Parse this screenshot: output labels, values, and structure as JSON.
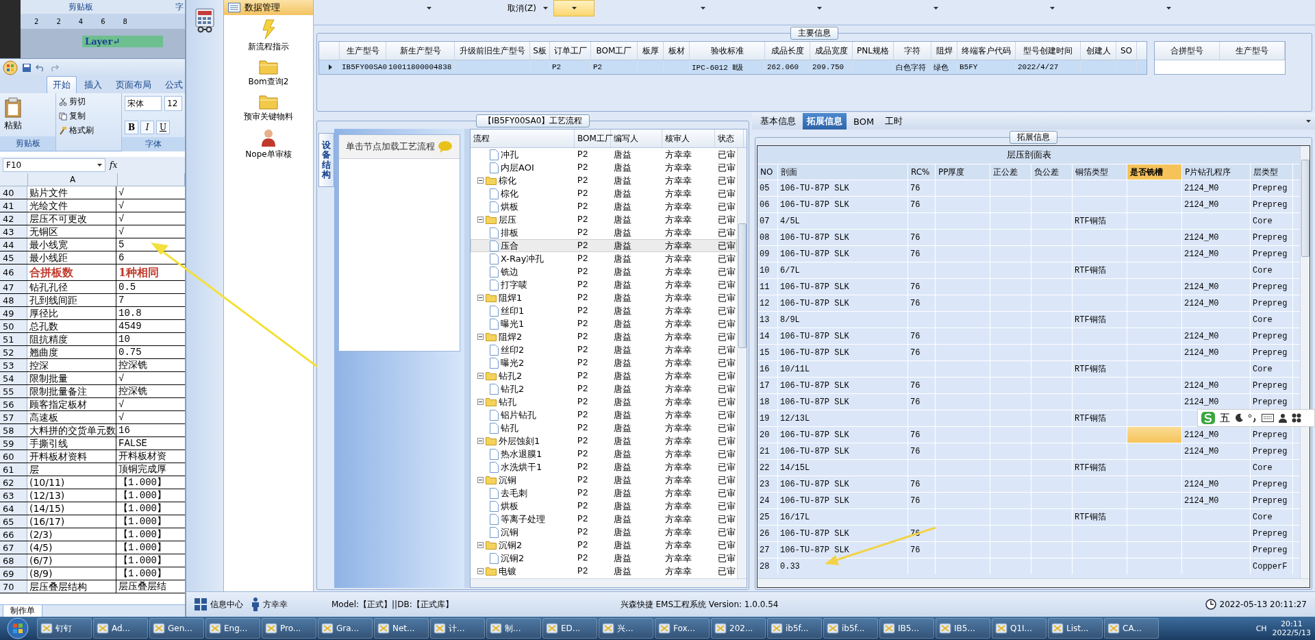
{
  "word_window": {
    "ribbon_groups": [
      "剪贴板",
      "字"
    ],
    "ruler_numbers": [
      "2",
      "2",
      "4",
      "6",
      "8"
    ],
    "cell_text": "Layer↵"
  },
  "excel": {
    "tabs": [
      {
        "label": "开始",
        "selected": true
      },
      {
        "label": "插入",
        "selected": false
      },
      {
        "label": "页面布局",
        "selected": false
      },
      {
        "label": "公式",
        "selected": false
      }
    ],
    "clipboard": {
      "paste": "粘贴",
      "cut": "剪切",
      "copy": "复制",
      "format_painter": "格式刷",
      "group": "剪贴板"
    },
    "font": {
      "name": "宋体",
      "size": "12",
      "bold": "B",
      "italic": "I",
      "underline": "U",
      "group": "字体"
    },
    "name_box": "F10",
    "fx": "fx",
    "column": "A",
    "rows": [
      {
        "n": "40",
        "a": "贴片文件",
        "b": "√",
        "kind": "plain"
      },
      {
        "n": "41",
        "a": "光绘文件",
        "b": "√",
        "kind": "plain"
      },
      {
        "n": "42",
        "a": "层压不可更改",
        "b": "√",
        "kind": "plain"
      },
      {
        "n": "43",
        "a": "无铜区",
        "b": "√",
        "kind": "plain"
      },
      {
        "n": "44",
        "a": "最小线宽",
        "b": "5",
        "kind": "plain"
      },
      {
        "n": "45",
        "a": "最小线距",
        "b": "6",
        "kind": "plain"
      },
      {
        "n": "46",
        "a": "合拼板数",
        "b": "1种相同",
        "kind": "emphasis"
      },
      {
        "n": "47",
        "a": "钻孔孔径",
        "b": "0.5",
        "kind": "plain"
      },
      {
        "n": "48",
        "a": "孔到线间距",
        "b": "7",
        "kind": "plain"
      },
      {
        "n": "49",
        "a": "厚径比",
        "b": "10.8",
        "kind": "plain"
      },
      {
        "n": "50",
        "a": "总孔数",
        "b": "4549",
        "kind": "plain"
      },
      {
        "n": "51",
        "a": "阻抗精度",
        "b": "10",
        "kind": "plain"
      },
      {
        "n": "52",
        "a": "翘曲度",
        "b": "0.75",
        "kind": "plain"
      },
      {
        "n": "53",
        "a": "控深",
        "b": "控深铣",
        "kind": "plain"
      },
      {
        "n": "54",
        "a": "限制批量",
        "b": "√",
        "kind": "plain"
      },
      {
        "n": "55",
        "a": "限制批量备注",
        "b": "控深铣",
        "kind": "plain"
      },
      {
        "n": "56",
        "a": "顾客指定板材",
        "b": "√",
        "kind": "plain"
      },
      {
        "n": "57",
        "a": "高速板",
        "b": "√",
        "kind": "plain"
      },
      {
        "n": "58",
        "a": "大料拼的交货单元数",
        "b": "16",
        "kind": "plain"
      },
      {
        "n": "59",
        "a": "手撕引线",
        "b": "FALSE",
        "kind": "plain"
      },
      {
        "n": "60",
        "a": "开料板材资料",
        "b": "开料板材资",
        "kind": "plain"
      },
      {
        "n": "61",
        "a": "层",
        "b": "顶铜完成厚",
        "kind": "plain"
      },
      {
        "n": "62",
        "a": "(10/11)",
        "b": "【1.000】",
        "kind": "plain"
      },
      {
        "n": "63",
        "a": "(12/13)",
        "b": "【1.000】",
        "kind": "plain"
      },
      {
        "n": "64",
        "a": "(14/15)",
        "b": "【1.000】",
        "kind": "plain"
      },
      {
        "n": "65",
        "a": "(16/17)",
        "b": "【1.000】",
        "kind": "plain"
      },
      {
        "n": "66",
        "a": "(2/3)",
        "b": "【1.000】",
        "kind": "plain"
      },
      {
        "n": "67",
        "a": "(4/5)",
        "b": "【1.000】",
        "kind": "plain"
      },
      {
        "n": "68",
        "a": "(6/7)",
        "b": "【1.000】",
        "kind": "plain"
      },
      {
        "n": "69",
        "a": "(8/9)",
        "b": "【1.000】",
        "kind": "plain"
      },
      {
        "n": "70",
        "a": "层压叠层结构",
        "b": "层压叠层结",
        "kind": "plain"
      }
    ],
    "sheet_tab": "制作单"
  },
  "app": {
    "nav": {
      "header": "数据管理",
      "items": [
        {
          "label": "新流程指示",
          "kind": "lightning"
        },
        {
          "label": "Bom查询2",
          "kind": "folder"
        },
        {
          "label": "预审关键物料",
          "kind": "folder"
        },
        {
          "label": "Nope单审核",
          "kind": "person"
        }
      ]
    },
    "toolbar": [
      {
        "selected": false
      },
      {
        "label": "取消(Z)",
        "selected": false
      },
      {
        "selected": true
      },
      {
        "selected": false
      },
      {
        "selected": false
      },
      {
        "selected": false
      },
      {
        "selected": false
      },
      {
        "selected": false
      }
    ],
    "main_info": {
      "title": "主要信息",
      "row_selected": true,
      "columns": [
        {
          "label": "生产型号",
          "value": "IB5FY00SA0"
        },
        {
          "label": "新生产型号",
          "value": "10011800004838"
        },
        {
          "label": "升级前旧生产型号"
        },
        {
          "label": "S板"
        },
        {
          "label": "订单工厂",
          "value": "P2"
        },
        {
          "label": "BOM工厂",
          "value": "P2"
        },
        {
          "label": "板厚"
        },
        {
          "label": "板材"
        },
        {
          "label": "验收标准",
          "value": "IPC-6012 Ⅱ级"
        },
        {
          "label": "成品长度",
          "value": "262.060"
        },
        {
          "label": "成品宽度",
          "value": "209.750"
        },
        {
          "label": "PNL规格"
        },
        {
          "label": "字符",
          "value": "白色字符"
        },
        {
          "label": "阻焊",
          "value": "绿色"
        },
        {
          "label": "终端客户代码",
          "value": "B5FY"
        },
        {
          "label": "型号创建时间",
          "value": "2022/4/27"
        },
        {
          "label": "创建人"
        },
        {
          "label": "SO"
        }
      ],
      "merge_columns": [
        "合拼型号",
        "生产型号"
      ]
    },
    "flow": {
      "title": "【IB5FY00SA0】工艺流程",
      "side_tab": "设备结构",
      "hint": "单击节点加载工艺流程",
      "columns": [
        "流程",
        "BOM工厂",
        "编写人",
        "核审人",
        "状态"
      ],
      "nodes": [
        {
          "children": [
            {
              "kind": "step",
              "label": "冲孔",
              "bom": "P2",
              "writer": "唐益",
              "reviewer": "方幸幸",
              "status": "已审",
              "selected": false
            },
            {
              "kind": "step",
              "label": "内层AOI",
              "bom": "P2",
              "writer": "唐益",
              "reviewer": "方幸幸",
              "status": "已审",
              "selected": false
            }
          ]
        },
        {
          "kind": "folder",
          "expanded": true,
          "label": "棕化",
          "bom": "P2",
          "writer": "唐益",
          "reviewer": "方幸幸",
          "status": "已审",
          "selected": false,
          "children": [
            {
              "kind": "step",
              "label": "棕化",
              "bom": "P2",
              "writer": "唐益",
              "reviewer": "方幸幸",
              "status": "已审",
              "selected": false
            },
            {
              "kind": "step",
              "label": "烘板",
              "bom": "P2",
              "writer": "唐益",
              "reviewer": "方幸幸",
              "status": "已审",
              "selected": false
            }
          ]
        },
        {
          "kind": "folder",
          "expanded": true,
          "label": "层压",
          "bom": "P2",
          "writer": "唐益",
          "reviewer": "方幸幸",
          "status": "已审",
          "selected": false,
          "children": [
            {
              "kind": "step",
              "label": "排板",
              "bom": "P2",
              "writer": "唐益",
              "reviewer": "方幸幸",
              "status": "已审",
              "selected": false
            },
            {
              "kind": "step",
              "label": "压合",
              "bom": "P2",
              "writer": "唐益",
              "reviewer": "方幸幸",
              "status": "已审",
              "selected": true
            },
            {
              "kind": "step",
              "label": "X-Ray冲孔",
              "bom": "P2",
              "writer": "唐益",
              "reviewer": "方幸幸",
              "status": "已审",
              "selected": false
            },
            {
              "kind": "step",
              "label": "铣边",
              "bom": "P2",
              "writer": "唐益",
              "reviewer": "方幸幸",
              "status": "已审",
              "selected": false
            },
            {
              "kind": "step",
              "label": "打字唛",
              "bom": "P2",
              "writer": "唐益",
              "reviewer": "方幸幸",
              "status": "已审",
              "selected": false
            }
          ]
        },
        {
          "kind": "folder",
          "expanded": true,
          "label": "阻焊1",
          "bom": "P2",
          "writer": "唐益",
          "reviewer": "方幸幸",
          "status": "已审",
          "selected": false,
          "children": [
            {
              "kind": "step",
              "label": "丝印1",
              "bom": "P2",
              "writer": "唐益",
              "reviewer": "方幸幸",
              "status": "已审",
              "selected": false
            },
            {
              "kind": "step",
              "label": "曝光1",
              "bom": "P2",
              "writer": "唐益",
              "reviewer": "方幸幸",
              "status": "已审",
              "selected": false
            }
          ]
        },
        {
          "kind": "folder",
          "expanded": true,
          "label": "阻焊2",
          "bom": "P2",
          "writer": "唐益",
          "reviewer": "方幸幸",
          "status": "已审",
          "selected": false,
          "children": [
            {
              "kind": "step",
              "label": "丝印2",
              "bom": "P2",
              "writer": "唐益",
              "reviewer": "方幸幸",
              "status": "已审",
              "selected": false
            },
            {
              "kind": "step",
              "label": "曝光2",
              "bom": "P2",
              "writer": "唐益",
              "reviewer": "方幸幸",
              "status": "已审",
              "selected": false
            }
          ]
        },
        {
          "kind": "folder",
          "expanded": true,
          "label": "钻孔2",
          "bom": "P2",
          "writer": "唐益",
          "reviewer": "方幸幸",
          "status": "已审",
          "selected": false,
          "children": [
            {
              "kind": "step",
              "label": "钻孔2",
              "bom": "P2",
              "writer": "唐益",
              "reviewer": "方幸幸",
              "status": "已审",
              "selected": false
            }
          ]
        },
        {
          "kind": "folder",
          "expanded": true,
          "label": "钻孔",
          "bom": "P2",
          "writer": "唐益",
          "reviewer": "方幸幸",
          "status": "已审",
          "selected": false,
          "children": [
            {
              "kind": "step",
              "label": "铝片钻孔",
              "bom": "P2",
              "writer": "唐益",
              "reviewer": "方幸幸",
              "status": "已审",
              "selected": false
            },
            {
              "kind": "step",
              "label": "钻孔",
              "bom": "P2",
              "writer": "唐益",
              "reviewer": "方幸幸",
              "status": "已审",
              "selected": false
            }
          ]
        },
        {
          "kind": "folder",
          "expanded": true,
          "label": "外层蚀刻1",
          "bom": "P2",
          "writer": "唐益",
          "reviewer": "方幸幸",
          "status": "已审",
          "selected": false,
          "children": [
            {
              "kind": "step",
              "label": "热水退膜1",
              "bom": "P2",
              "writer": "唐益",
              "reviewer": "方幸幸",
              "status": "已审",
              "selected": false
            },
            {
              "kind": "step",
              "label": "水洗烘干1",
              "bom": "P2",
              "writer": "唐益",
              "reviewer": "方幸幸",
              "status": "已审",
              "selected": false
            }
          ]
        },
        {
          "kind": "folder",
          "expanded": true,
          "label": "沉铜",
          "bom": "P2",
          "writer": "唐益",
          "reviewer": "方幸幸",
          "status": "已审",
          "selected": false,
          "children": [
            {
              "kind": "step",
              "label": "去毛刺",
              "bom": "P2",
              "writer": "唐益",
              "reviewer": "方幸幸",
              "status": "已审",
              "selected": false
            },
            {
              "kind": "step",
              "label": "烘板",
              "bom": "P2",
              "writer": "唐益",
              "reviewer": "方幸幸",
              "status": "已审",
              "selected": false
            },
            {
              "kind": "step",
              "label": "等离子处理",
              "bom": "P2",
              "writer": "唐益",
              "reviewer": "方幸幸",
              "status": "已审",
              "selected": false
            },
            {
              "kind": "step",
              "label": "沉铜",
              "bom": "P2",
              "writer": "唐益",
              "reviewer": "方幸幸",
              "status": "已审",
              "selected": false
            }
          ]
        },
        {
          "kind": "folder",
          "expanded": true,
          "label": "沉铜2",
          "bom": "P2",
          "writer": "唐益",
          "reviewer": "方幸幸",
          "status": "已审",
          "selected": false,
          "children": [
            {
              "kind": "step",
              "label": "沉铜2",
              "bom": "P2",
              "writer": "唐益",
              "reviewer": "方幸幸",
              "status": "已审",
              "selected": false
            }
          ]
        },
        {
          "kind": "folder",
          "expanded": true,
          "label": "电镀",
          "bom": "P2",
          "writer": "唐益",
          "reviewer": "方幸幸",
          "status": "已审",
          "selected": false
        }
      ]
    },
    "ext": {
      "tabs": [
        {
          "label": "基本信息",
          "selected": false
        },
        {
          "label": "拓展信息",
          "selected": true
        },
        {
          "label": "BOM",
          "selected": false
        },
        {
          "label": "工时",
          "selected": false
        }
      ],
      "title": "拓展信息",
      "table_title": "层压剖面表",
      "columns": [
        {
          "label": "NO",
          "selected": false
        },
        {
          "label": "剖面",
          "selected": false
        },
        {
          "label": "RC%",
          "selected": false
        },
        {
          "label": "PP厚度",
          "selected": false
        },
        {
          "label": "正公差",
          "selected": false
        },
        {
          "label": "负公差",
          "selected": false
        },
        {
          "label": "铜箔类型",
          "selected": false
        },
        {
          "label": "是否铣槽",
          "selected": true
        },
        {
          "label": "P片钻孔程序",
          "selected": false
        },
        {
          "label": "层类型",
          "selected": false
        }
      ],
      "rows": [
        {
          "no": "05",
          "section": "106-TU-87P SLK",
          "rc": "76",
          "drill": "2124_M0",
          "type": "Prepreg",
          "selected": false
        },
        {
          "no": "06",
          "section": "106-TU-87P SLK",
          "rc": "76",
          "drill": "2124_M0",
          "type": "Prepreg",
          "selected": false
        },
        {
          "no": "07",
          "section": "4/5L",
          "copper": "RTF铜箔",
          "type": "Core",
          "selected": false
        },
        {
          "no": "08",
          "section": "106-TU-87P SLK",
          "rc": "76",
          "drill": "2124_M0",
          "type": "Prepreg",
          "selected": false
        },
        {
          "no": "09",
          "section": "106-TU-87P SLK",
          "rc": "76",
          "drill": "2124_M0",
          "type": "Prepreg",
          "selected": false
        },
        {
          "no": "10",
          "section": "6/7L",
          "copper": "RTF铜箔",
          "type": "Core",
          "selected": false
        },
        {
          "no": "11",
          "section": "106-TU-87P SLK",
          "rc": "76",
          "drill": "2124_M0",
          "type": "Prepreg",
          "selected": false
        },
        {
          "no": "12",
          "section": "106-TU-87P SLK",
          "rc": "76",
          "drill": "2124_M0",
          "type": "Prepreg",
          "selected": false
        },
        {
          "no": "13",
          "section": "8/9L",
          "copper": "RTF铜箔",
          "type": "Core",
          "selected": false
        },
        {
          "no": "14",
          "section": "106-TU-87P SLK",
          "rc": "76",
          "drill": "2124_M0",
          "type": "Prepreg",
          "selected": false
        },
        {
          "no": "15",
          "section": "106-TU-87P SLK",
          "rc": "76",
          "drill": "2124_M0",
          "type": "Prepreg",
          "selected": false
        },
        {
          "no": "16",
          "section": "10/11L",
          "copper": "RTF铜箔",
          "type": "Core",
          "selected": false
        },
        {
          "no": "17",
          "section": "106-TU-87P SLK",
          "rc": "76",
          "drill": "2124_M0",
          "type": "Prepreg",
          "selected": false
        },
        {
          "no": "18",
          "section": "106-TU-87P SLK",
          "rc": "76",
          "drill": "2124_M0",
          "type": "Prepreg",
          "selected": false
        },
        {
          "no": "19",
          "section": "12/13L",
          "copper": "RTF铜箔",
          "selected": false
        },
        {
          "no": "20",
          "section": "106-TU-87P SLK",
          "rc": "76",
          "drill": "2124_M0",
          "type": "Prepreg",
          "selected": true
        },
        {
          "no": "21",
          "section": "106-TU-87P SLK",
          "rc": "76",
          "drill": "2124_M0",
          "type": "Prepreg",
          "selected": false
        },
        {
          "no": "22",
          "section": "14/15L",
          "copper": "RTF铜箔",
          "type": "Core",
          "selected": false
        },
        {
          "no": "23",
          "section": "106-TU-87P SLK",
          "rc": "76",
          "drill": "2124_M0",
          "type": "Prepreg",
          "selected": false
        },
        {
          "no": "24",
          "section": "106-TU-87P SLK",
          "rc": "76",
          "drill": "2124_M0",
          "type": "Prepreg",
          "selected": false
        },
        {
          "no": "25",
          "section": "16/17L",
          "copper": "RTF铜箔",
          "type": "Core",
          "selected": false
        },
        {
          "no": "26",
          "section": "106-TU-87P SLK",
          "rc": "76",
          "type": "Prepreg",
          "selected": false
        },
        {
          "no": "27",
          "section": "106-TU-87P SLK",
          "rc": "76",
          "type": "Prepreg",
          "selected": false
        },
        {
          "no": "28",
          "section": "0.33",
          "type": "CopperF",
          "selected": false
        }
      ]
    },
    "status_bar": {
      "info_center": "信息中心",
      "user": "方幸幸",
      "model": "Model:【正式】||DB:【正式库】",
      "version": "兴森快捷 EMS工程系统 Version: 1.0.0.54",
      "time": "2022-05-13 20:11:27"
    }
  },
  "ime": {
    "mode": "五"
  },
  "taskbar": {
    "items": [
      {
        "label": "钉钉"
      },
      {
        "label": "Ad..."
      },
      {
        "label": "Gen..."
      },
      {
        "label": "Eng..."
      },
      {
        "label": "Pro..."
      },
      {
        "label": "Gra..."
      },
      {
        "label": "Net..."
      },
      {
        "label": "计..."
      },
      {
        "label": "制..."
      },
      {
        "label": "ED..."
      },
      {
        "label": "兴..."
      },
      {
        "label": "Fox..."
      },
      {
        "label": "202..."
      },
      {
        "label": "ib5f..."
      },
      {
        "label": "ib5f..."
      },
      {
        "label": "IB5..."
      },
      {
        "label": "IB5..."
      },
      {
        "label": "Q1I..."
      },
      {
        "label": "List..."
      },
      {
        "label": "CA..."
      }
    ],
    "lang": "CH",
    "time": "20:11",
    "date": "2022/5/13"
  }
}
